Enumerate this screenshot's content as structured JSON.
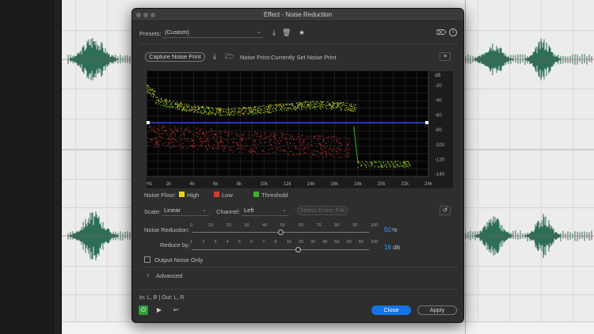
{
  "dialog": {
    "title": "Effect - Noise Reduction",
    "presets_label": "Presets:",
    "preset_value": "(Custom)",
    "capture_button": "Capture Noise Print",
    "noise_print_label": "Noise Print:",
    "noise_print_value": "Currently Set Noise Print",
    "db_label": "dB",
    "db_ticks": [
      "-20",
      "-40",
      "-60",
      "-80",
      "-100",
      "-120",
      "-140"
    ],
    "freq_ticks": [
      "Hz",
      "2k",
      "4k",
      "6k",
      "8k",
      "10k",
      "12k",
      "14k",
      "16k",
      "18k",
      "20k",
      "22k",
      "24k"
    ],
    "noise_floor_label": "Noise Floor:",
    "legend_high": "High",
    "legend_low": "Low",
    "legend_threshold": "Threshold",
    "scale_label": "Scale:",
    "scale_value": "Linear",
    "channel_label": "Channel:",
    "channel_value": "Left",
    "select_entire_file": "Select Entire File",
    "noise_reduction_label": "Noise Reduction:",
    "noise_reduction_ticks": [
      "0",
      "10",
      "20",
      "30",
      "40",
      "50",
      "60",
      "70",
      "80",
      "90",
      "100"
    ],
    "noise_reduction_value": "50",
    "noise_reduction_unit": "%",
    "reduce_by_label": "Reduce by:",
    "reduce_by_ticks": [
      "1",
      "2",
      "3",
      "4",
      "5",
      "6",
      "7",
      "8",
      "10",
      "20",
      "30",
      "40",
      "50",
      "60",
      "80",
      "100"
    ],
    "reduce_by_value": "16",
    "reduce_by_unit": "dB",
    "output_noise_only": "Output Noise Only",
    "advanced_label": "Advanced",
    "io_label": "In: L, R | Out: L, R",
    "close_button": "Close",
    "apply_button": "Apply"
  },
  "colors": {
    "high": "#e8d21a",
    "low": "#d63a2f",
    "threshold": "#3fae2e",
    "threshold_line": "#3a4bff",
    "accent": "#1473e6",
    "waveform": "#2f6e56"
  },
  "icons": [
    "chevron-down-icon",
    "import-icon",
    "trash-icon",
    "star-icon",
    "routing-icon",
    "info-icon",
    "folder-icon",
    "menu-icon",
    "reset-icon",
    "chevron-right-icon",
    "power-icon",
    "play-icon",
    "loop-icon"
  ]
}
